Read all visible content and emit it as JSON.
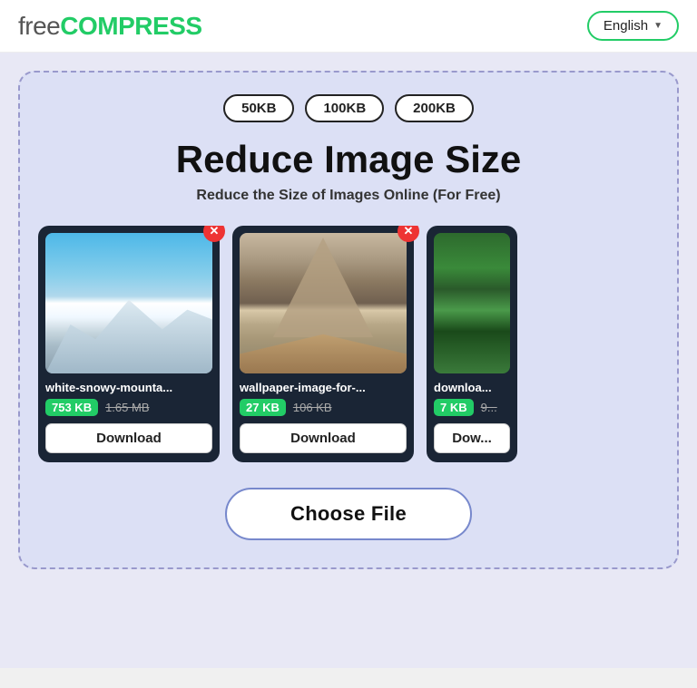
{
  "header": {
    "logo_free": "free",
    "logo_compress": "COMPRESS",
    "lang_button_label": "English",
    "lang_chevron": "▼"
  },
  "size_badges": [
    {
      "label": "50KB",
      "id": "badge-50kb"
    },
    {
      "label": "100KB",
      "id": "badge-100kb"
    },
    {
      "label": "200KB",
      "id": "badge-200kb"
    }
  ],
  "main": {
    "title": "Reduce Image Size",
    "subtitle": "Reduce the Size of Images Online (For Free)"
  },
  "images": [
    {
      "filename": "white-snowy-mounta...",
      "size_new": "753 KB",
      "size_old": "1.65 MB",
      "type": "snow",
      "download_label": "Download"
    },
    {
      "filename": "wallpaper-image-for-...",
      "size_new": "27 KB",
      "size_old": "106 KB",
      "type": "mountain",
      "download_label": "Download"
    },
    {
      "filename": "downloa...",
      "size_new": "7 KB",
      "size_old": "9...",
      "type": "forest",
      "download_label": "Dow..."
    }
  ],
  "choose_file_label": "Choose File"
}
